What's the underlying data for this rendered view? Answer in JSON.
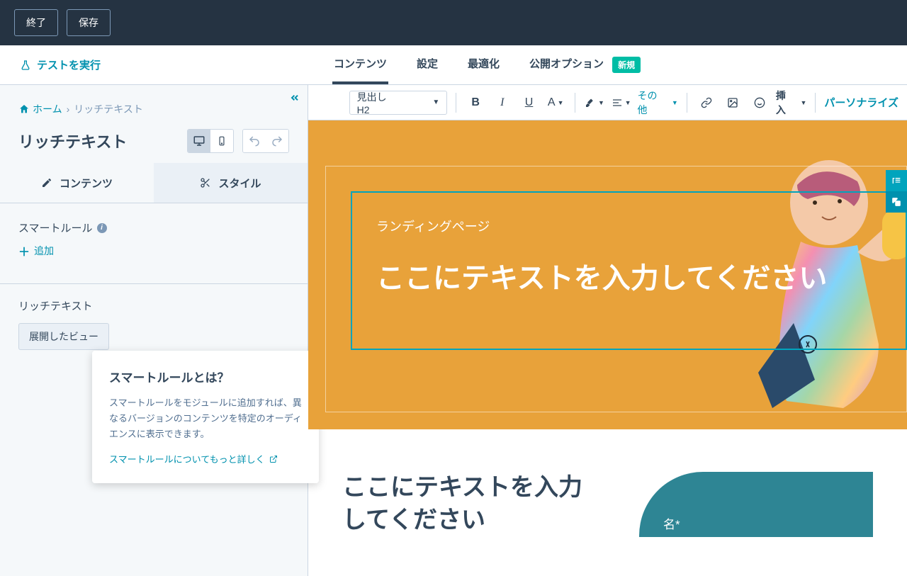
{
  "topbar": {
    "exit": "終了",
    "save": "保存"
  },
  "navbar": {
    "run_test": "テストを実行",
    "tabs": {
      "contents": "コンテンツ",
      "settings": "設定",
      "optimize": "最適化",
      "publish": "公開オプション"
    },
    "new_badge": "新規"
  },
  "breadcrumb": {
    "home": "ホーム",
    "current": "リッチテキスト"
  },
  "sidebar": {
    "title": "リッチテキスト",
    "panel_tabs": {
      "contents": "コンテンツ",
      "style": "スタイル"
    },
    "smart_rule_label": "スマートルール",
    "add": "追加",
    "rich_text_label": "リッチテキスト",
    "expand_button": "展開したビュー"
  },
  "tooltip": {
    "title": "スマートルールとは？",
    "body": "スマートルールをモジュールに追加すれば、異なるバージョンのコンテンツを特定のオーディエンスに表示できます。",
    "link": "スマートルールについてもっと詳しく"
  },
  "editor": {
    "heading_select": "見出しH2",
    "more": "その他",
    "insert": "挿入",
    "personalize": "パーソナライズ"
  },
  "hero": {
    "subtitle": "ランディングページ",
    "heading": "ここにテキストを入力してください"
  },
  "content": {
    "heading": "ここにテキストを入力してください"
  },
  "form": {
    "field1": "名*"
  }
}
